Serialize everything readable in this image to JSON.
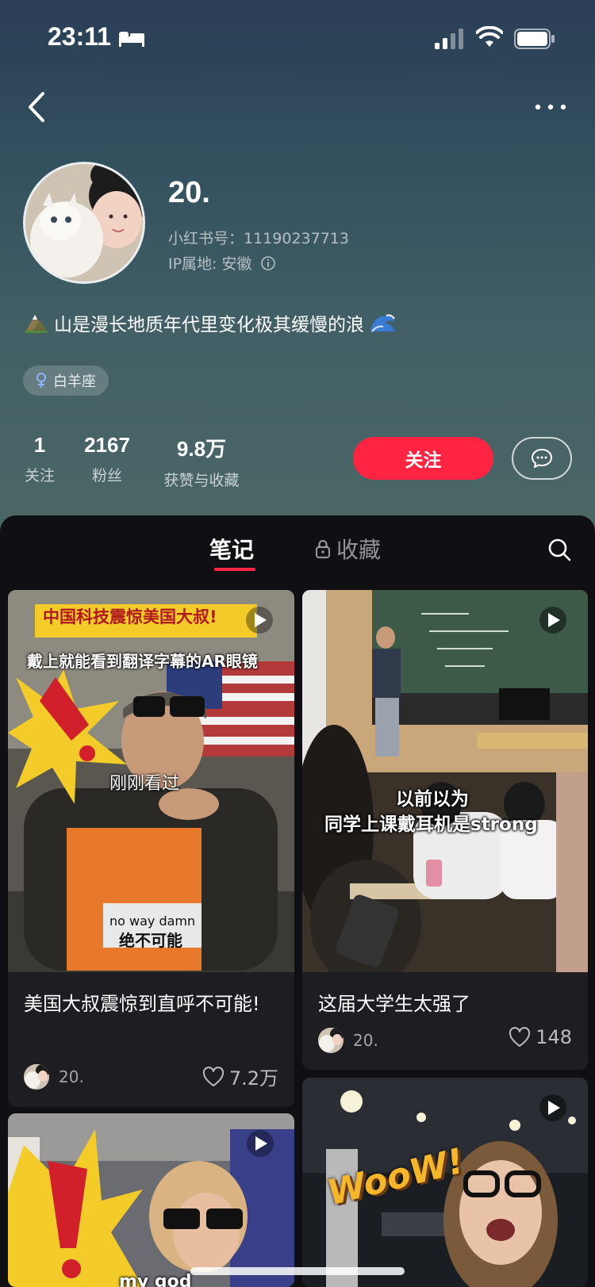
{
  "status_bar": {
    "time": "23:11",
    "icons": [
      "bed-icon",
      "signal-icon",
      "wifi-icon",
      "battery-icon"
    ]
  },
  "nav": {
    "back_icon": "chevron-left-icon",
    "more_icon": "more-horizontal-icon"
  },
  "profile": {
    "nickname": "20.",
    "user_id": "小红书号：11190237713",
    "ip_location": "IP属地: 安徽",
    "bio": "山是漫长地质年代里变化极其缓慢的浪",
    "bio_emojis": [
      "mountain-emoji",
      "wave-emoji"
    ],
    "tag": "白羊座"
  },
  "stats": [
    {
      "value": "1",
      "label": "关注"
    },
    {
      "value": "2167",
      "label": "粉丝"
    },
    {
      "value": "9.8万",
      "label": "获赞与收藏"
    }
  ],
  "actions": {
    "follow_label": "关注",
    "message_icon": "chat-bubble-icon"
  },
  "tabs": [
    {
      "label": "笔记",
      "active": true
    },
    {
      "label": "收藏",
      "active": false,
      "locked": true
    }
  ],
  "notes": [
    {
      "title": "美国大叔震惊到直呼不可能!",
      "author": "20.",
      "likes": "7.2万",
      "overlay_top": "中国科技震惊美国大叔!",
      "overlay_sub": "戴上就能看到翻译字幕的AR眼镜",
      "overlay_mid": "刚刚看过",
      "overlay_bottom_en": "no way damn",
      "overlay_bottom_cn": "绝不可能",
      "is_video": true
    },
    {
      "title": "这届大学生太强了",
      "author": "20.",
      "likes": "148",
      "overlay_line1": "以前以为",
      "overlay_line2": "同学上课戴耳机是strong",
      "is_video": true
    },
    {
      "overlay_bottom": "my god",
      "is_video": true
    },
    {
      "overlay_sticker": "WooW!",
      "is_video": true
    }
  ],
  "colors": {
    "accent": "#ff2442",
    "panel": "#101014",
    "card": "#1d1d22"
  }
}
